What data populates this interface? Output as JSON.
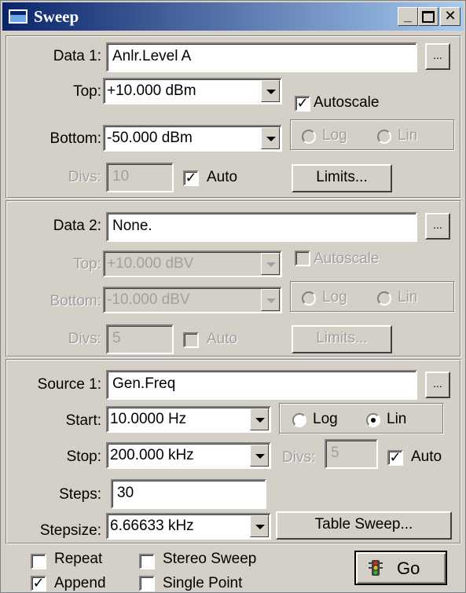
{
  "window": {
    "title": "Sweep"
  },
  "data1": {
    "label": "Data 1:",
    "value": "Anlr.Level A",
    "browse": "...",
    "top_label": "Top:",
    "top_value": "+10.000  dBm",
    "autoscale_label": "Autoscale",
    "autoscale_checked": true,
    "bottom_label": "Bottom:",
    "bottom_value": "-50.000  dBm",
    "log_label": "Log",
    "lin_label": "Lin",
    "divs_label": "Divs:",
    "divs_value": "10",
    "auto_label": "Auto",
    "auto_checked": true,
    "limits_label": "Limits..."
  },
  "data2": {
    "label": "Data 2:",
    "value": "None.",
    "browse": "...",
    "top_label": "Top:",
    "top_value": "+10.000  dBV",
    "autoscale_label": "Autoscale",
    "autoscale_checked": false,
    "bottom_label": "Bottom:",
    "bottom_value": "-10.000  dBV",
    "log_label": "Log",
    "lin_label": "Lin",
    "divs_label": "Divs:",
    "divs_value": "5",
    "auto_label": "Auto",
    "auto_checked": false,
    "limits_label": "Limits..."
  },
  "source1": {
    "label": "Source 1:",
    "value": "Gen.Freq",
    "browse": "...",
    "start_label": "Start:",
    "start_value": "10.0000  Hz",
    "stop_label": "Stop:",
    "stop_value": "200.000 kHz",
    "log_label": "Log",
    "lin_label": "Lin",
    "selected_scale": "Lin",
    "divs_label": "Divs:",
    "divs_value": "5",
    "auto_label": "Auto",
    "auto_checked": true,
    "steps_label": "Steps:",
    "steps_value": "30",
    "stepsize_label": "Stepsize:",
    "stepsize_value": "6.66633 kHz",
    "table_sweep_label": "Table Sweep..."
  },
  "options": {
    "repeat_label": "Repeat",
    "repeat_checked": false,
    "stereo_label": "Stereo Sweep",
    "stereo_checked": false,
    "append_label": "Append",
    "append_checked": true,
    "single_label": "Single Point",
    "single_checked": false,
    "go_label": "Go",
    "go_icon": "traffic-light-icon"
  }
}
